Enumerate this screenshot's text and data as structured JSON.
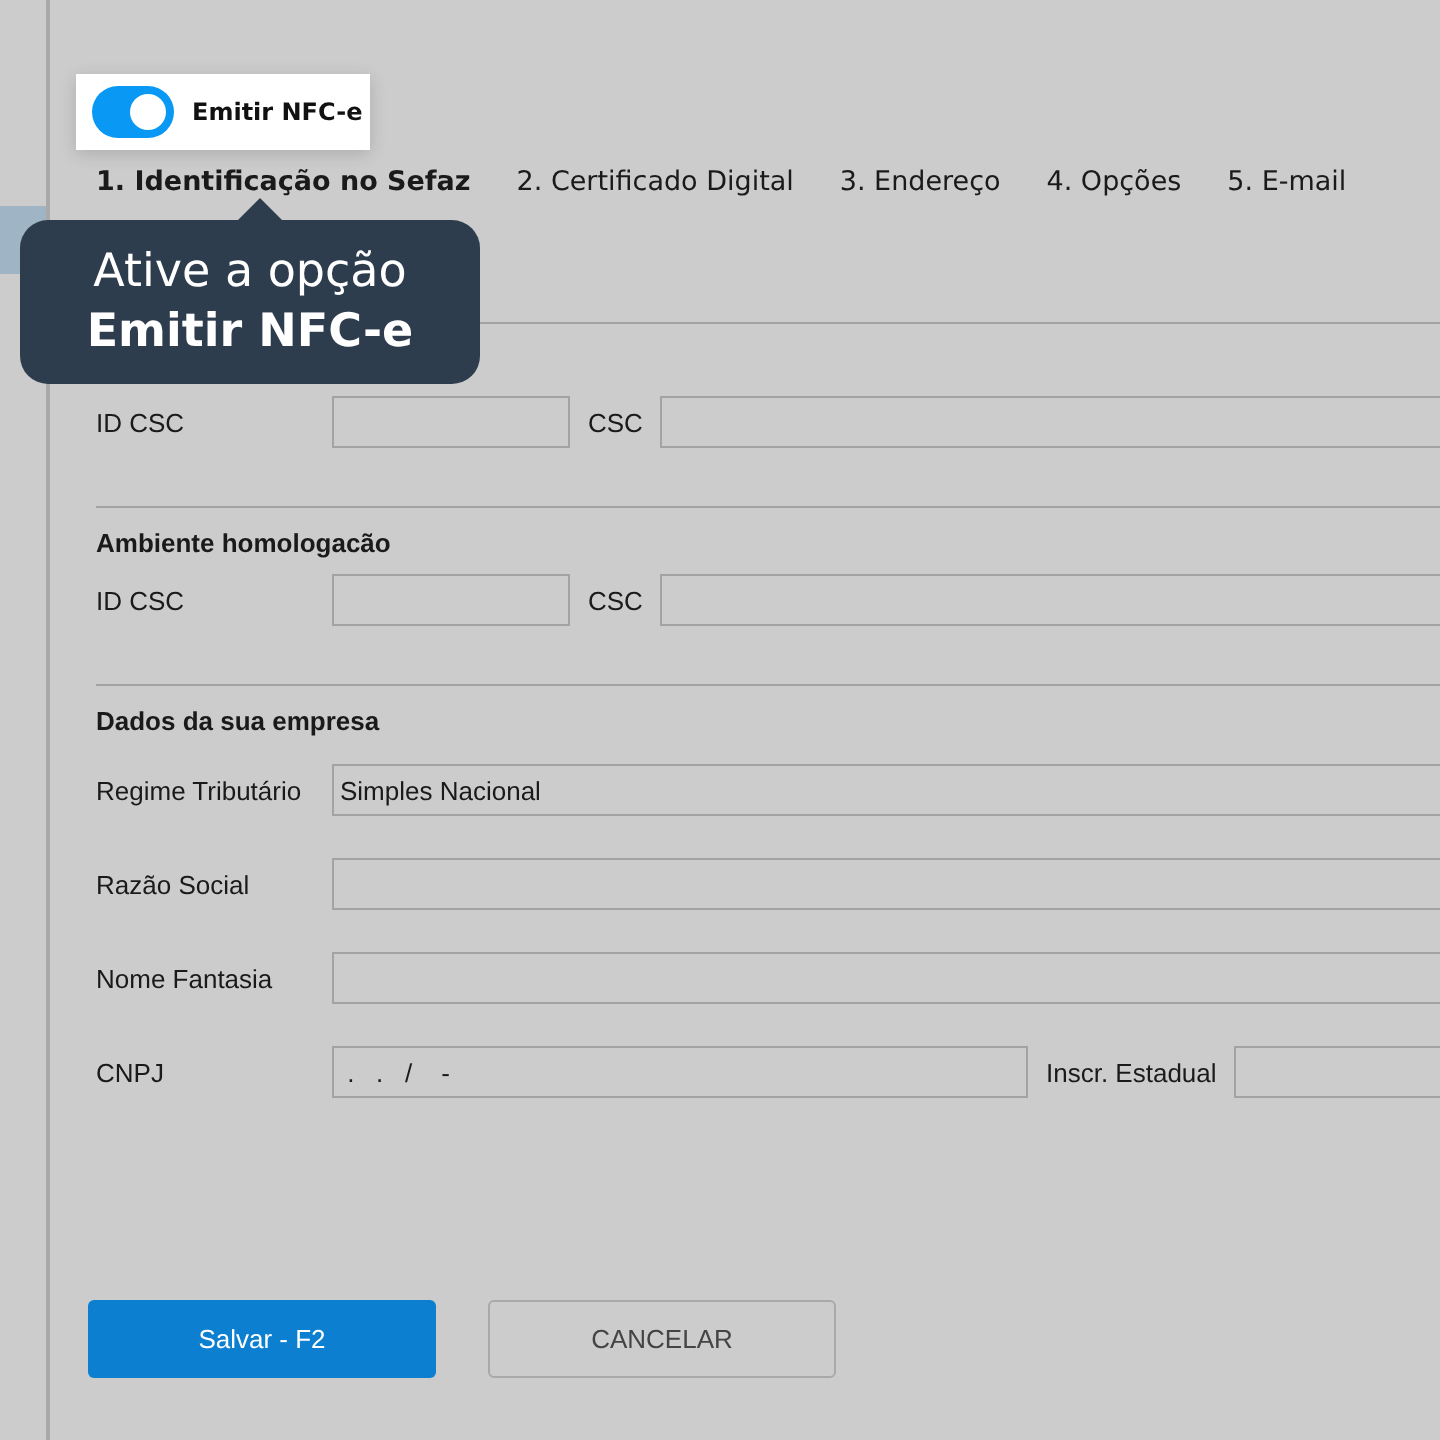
{
  "toggle": {
    "label": "Emitir NFC-e",
    "on": true
  },
  "tooltip": {
    "text": "Ative a opção",
    "highlight": "Emitir NFC-e"
  },
  "tabs": [
    {
      "label": "1. Identificação no Sefaz",
      "selected": true
    },
    {
      "label": "2. Certificado Digital",
      "selected": false
    },
    {
      "label": "3. Endereço",
      "selected": false
    },
    {
      "label": "4. Opções",
      "selected": false
    },
    {
      "label": "5. E-mail",
      "selected": false
    }
  ],
  "sections": [
    {
      "rows": [
        {
          "fields": [
            {
              "label": "ID CSC"
            },
            {
              "label": "CSC"
            }
          ]
        }
      ]
    },
    {
      "title": "Ambiente homologacão",
      "rows": [
        {
          "fields": [
            {
              "label": "ID CSC"
            },
            {
              "label": "CSC"
            }
          ]
        }
      ]
    },
    {
      "title": "Dados da sua empresa",
      "rows": [
        {
          "fields": [
            {
              "label": "Regime Tributário",
              "value": "Simples Nacional"
            }
          ]
        },
        {
          "fields": [
            {
              "label": "Razão Social"
            }
          ]
        },
        {
          "fields": [
            {
              "label": "Nome Fantasia"
            }
          ]
        },
        {
          "fields": [
            {
              "label": "CNPJ",
              "value": " .   .   /    -"
            },
            {
              "label": "Inscr. Estadual"
            }
          ]
        }
      ]
    }
  ],
  "buttons": [
    {
      "label": "Salvar - F2",
      "kind": "primary"
    },
    {
      "label": "CANCELAR",
      "kind": "secondary"
    }
  ]
}
